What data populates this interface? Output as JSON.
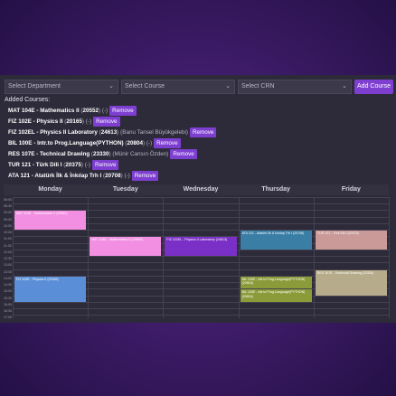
{
  "filters": {
    "department_placeholder": "Select Department",
    "course_placeholder": "Select Course",
    "crn_placeholder": "Select CRN",
    "add_label": "Add Course"
  },
  "added_title": "Added Courses:",
  "remove_label": "Remove",
  "courses": [
    {
      "code": "MAT 104E - Mathematics II",
      "crn": "20552",
      "instructor": "(-)"
    },
    {
      "code": "FIZ 102E - Physics II",
      "crn": "20165",
      "instructor": "(-)"
    },
    {
      "code": "FIZ 102EL - Physics II Laboratory",
      "crn": "24613",
      "instructor": "(Banu Tansel Büyükgelebi)"
    },
    {
      "code": "BIL 100E - Intr.to Prog.Language(PYTHON)",
      "crn": "20804",
      "instructor": "(-)"
    },
    {
      "code": "RES 107E - Technical Drawing",
      "crn": "23330",
      "instructor": "(Münir Cansın Özden)"
    },
    {
      "code": "TUR 121 - Türk Dili I",
      "crn": "20375",
      "instructor": "(-)"
    },
    {
      "code": "ATA 121 - Atatürk İlk & İnkılap Trh I",
      "crn": "20708",
      "instructor": "(-)"
    }
  ],
  "days": [
    "Monday",
    "Tuesday",
    "Wednesday",
    "Thursday",
    "Friday"
  ],
  "times": [
    "08:00",
    "08:30",
    "09:00",
    "09:30",
    "10:00",
    "10:30",
    "11:00",
    "11:30",
    "12:00",
    "12:30",
    "13:00",
    "13:30",
    "14:00",
    "14:30",
    "15:00",
    "15:30",
    "16:00",
    "16:30",
    "17:00"
  ],
  "events": [
    {
      "day": 0,
      "start": 2,
      "end": 5,
      "title": "MAT 104E - Mathematics II (20552)",
      "color": "#f28fe2"
    },
    {
      "day": 1,
      "start": 6,
      "end": 9,
      "title": "MAT 104E - Mathematics II (20552)",
      "color": "#f28fe2"
    },
    {
      "day": 2,
      "start": 6,
      "end": 9,
      "title": "FIZ 102EL - Physics II Laboratory (24613)",
      "color": "#7a2fc7"
    },
    {
      "day": 3,
      "start": 5,
      "end": 8,
      "title": "ATA 121 - Atatürk İlk & İnkılap Trh I (20708)",
      "color": "#3a7ea6"
    },
    {
      "day": 4,
      "start": 5,
      "end": 8,
      "title": "TUR 121 - Türk Dili I (20375)",
      "color": "#c99a98"
    },
    {
      "day": 0,
      "start": 12,
      "end": 16,
      "title": "FIZ 102E - Physics II (20165)",
      "color": "#5a8fd8"
    },
    {
      "day": 3,
      "start": 12,
      "end": 14,
      "title": "BIL 100E - Intr.to Prog.Language(PYTHON) (20804)",
      "color": "#8c9b3a"
    },
    {
      "day": 3,
      "start": 14,
      "end": 16,
      "title": "BIL 100E - Intr.to Prog.Language(PYTHON) (20804)",
      "color": "#8c9b3a"
    },
    {
      "day": 4,
      "start": 11,
      "end": 15,
      "title": "RES 107E - Technical Drawing (23330)",
      "color": "#b6ab8a"
    }
  ]
}
